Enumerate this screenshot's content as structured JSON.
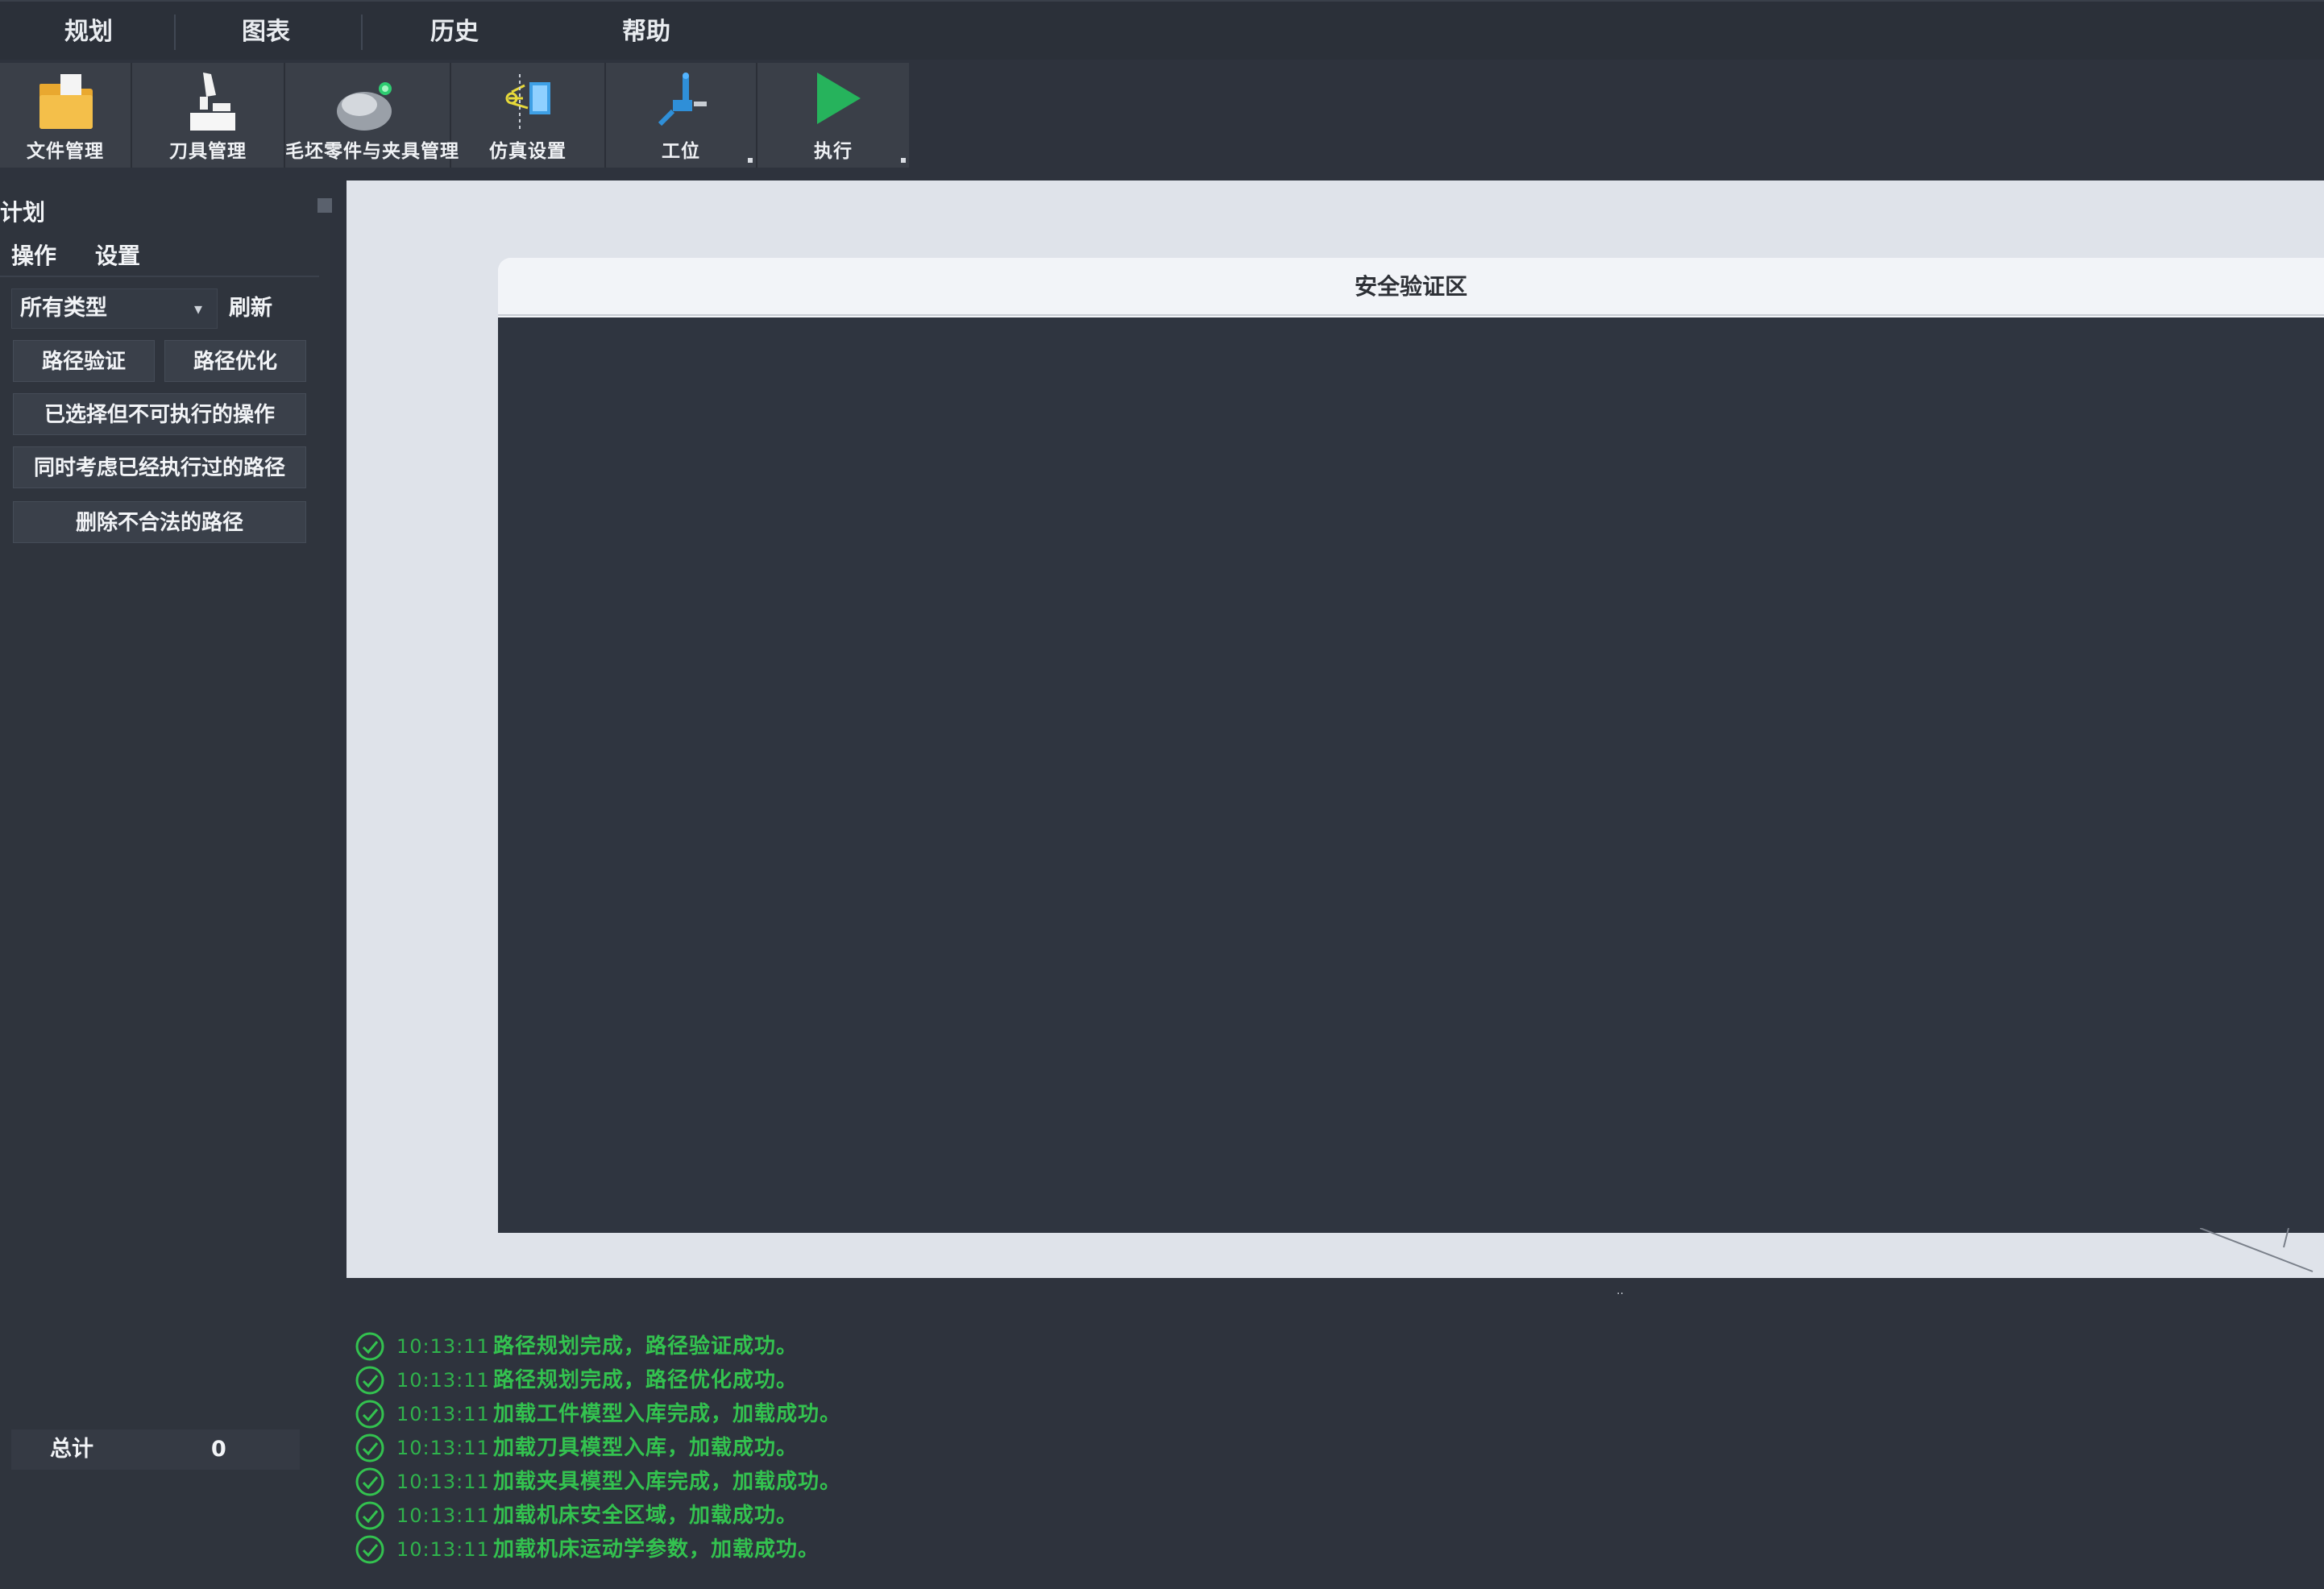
{
  "menu": [
    "规划",
    "图表",
    "历史",
    "帮助"
  ],
  "toolbar": {
    "tools": [
      {
        "label": "文件管理",
        "icon": "folder-icon"
      },
      {
        "label": "刀具管理",
        "icon": "tool-holder-icon"
      },
      {
        "label": "毛坯零件与夹具管理",
        "icon": "stock-part-icon"
      },
      {
        "label": "仿真设置",
        "icon": "simulation-setup-icon"
      },
      {
        "label": "工位",
        "icon": "robot-arm-icon"
      },
      {
        "label": "执行",
        "icon": "play-icon"
      }
    ]
  },
  "sidebar": {
    "title": "计划",
    "tabs": [
      "操作",
      "设置"
    ],
    "filter": {
      "value": "所有类型",
      "refresh_label": "刷新"
    },
    "buttons": [
      "路径验证",
      "路径优化",
      "已选择但不可执行的操作",
      "同时考虑已经执行过的路径",
      "删除不合法的路径"
    ],
    "footer": {
      "left": "总计",
      "right": "0"
    }
  },
  "viewport": {
    "title": "安全验证区"
  },
  "log": {
    "entries": [
      {
        "time": "10:13:11",
        "message": "路径规划完成，路径验证成功。"
      },
      {
        "time": "10:13:11",
        "message": "路径规划完成，路径优化成功。"
      },
      {
        "time": "10:13:11",
        "message": "加载工件模型入库完成，加载成功。"
      },
      {
        "time": "10:13:11",
        "message": "加载刀具模型入库，加载成功。"
      },
      {
        "time": "10:13:11",
        "message": "加载夹具模型入库完成，加载成功。"
      },
      {
        "time": "10:13:11",
        "message": "加载机床安全区域，加载成功。"
      },
      {
        "time": "10:13:11",
        "message": "加载机床运动学参数，加载成功。"
      }
    ]
  },
  "colors": {
    "background": "#2e333d",
    "log_green": "#33c24f",
    "play_green": "#26b35c",
    "folder": "#f0b73f"
  }
}
